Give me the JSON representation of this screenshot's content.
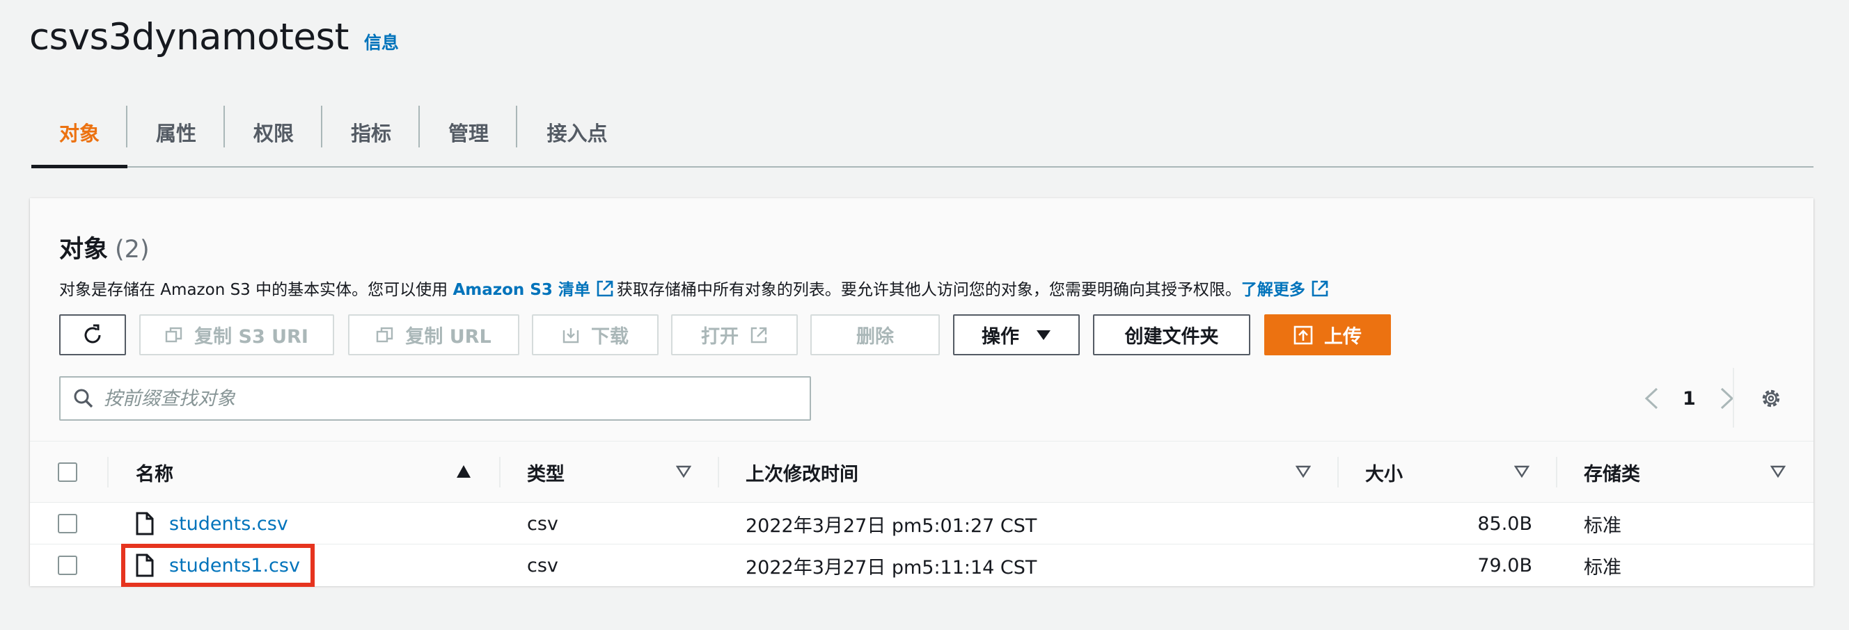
{
  "header": {
    "bucket_name": "csvs3dynamotest",
    "info_label": "信息"
  },
  "tabs": [
    {
      "label": "对象",
      "active": true
    },
    {
      "label": "属性"
    },
    {
      "label": "权限"
    },
    {
      "label": "指标"
    },
    {
      "label": "管理"
    },
    {
      "label": "接入点"
    }
  ],
  "objects_panel": {
    "title": "对象",
    "count": "(2)",
    "description": {
      "part1": "对象是存储在 Amazon S3 中的基本实体。您可以使用 ",
      "inventory_link": "Amazon S3 清单",
      "part2": "获取存储桶中所有对象的列表。要允许其他人访问您的对象，您需要明确向其授予权限。",
      "learn_more": "了解更多"
    }
  },
  "toolbar": {
    "copy_s3_uri": "复制 S3 URI",
    "copy_url": "复制 URL",
    "download": "下载",
    "open": "打开",
    "delete": "删除",
    "actions": "操作",
    "create_folder": "创建文件夹",
    "upload": "上传"
  },
  "search": {
    "placeholder": "按前缀查找对象"
  },
  "pagination": {
    "current_page": "1"
  },
  "table": {
    "columns": {
      "name": "名称",
      "type": "类型",
      "last_modified": "上次修改时间",
      "size": "大小",
      "storage_class": "存储类"
    },
    "rows": [
      {
        "name": "students.csv",
        "type": "csv",
        "last_modified": "2022年3月27日 pm5:01:27 CST",
        "size": "85.0B",
        "storage_class": "标准"
      },
      {
        "name": "students1.csv",
        "type": "csv",
        "last_modified": "2022年3月27日 pm5:11:14 CST",
        "size": "79.0B",
        "storage_class": "标准",
        "highlighted": true
      }
    ]
  },
  "colors": {
    "accent": "#ec7211",
    "link": "#0073bb",
    "highlight_box": "#e6341f"
  }
}
